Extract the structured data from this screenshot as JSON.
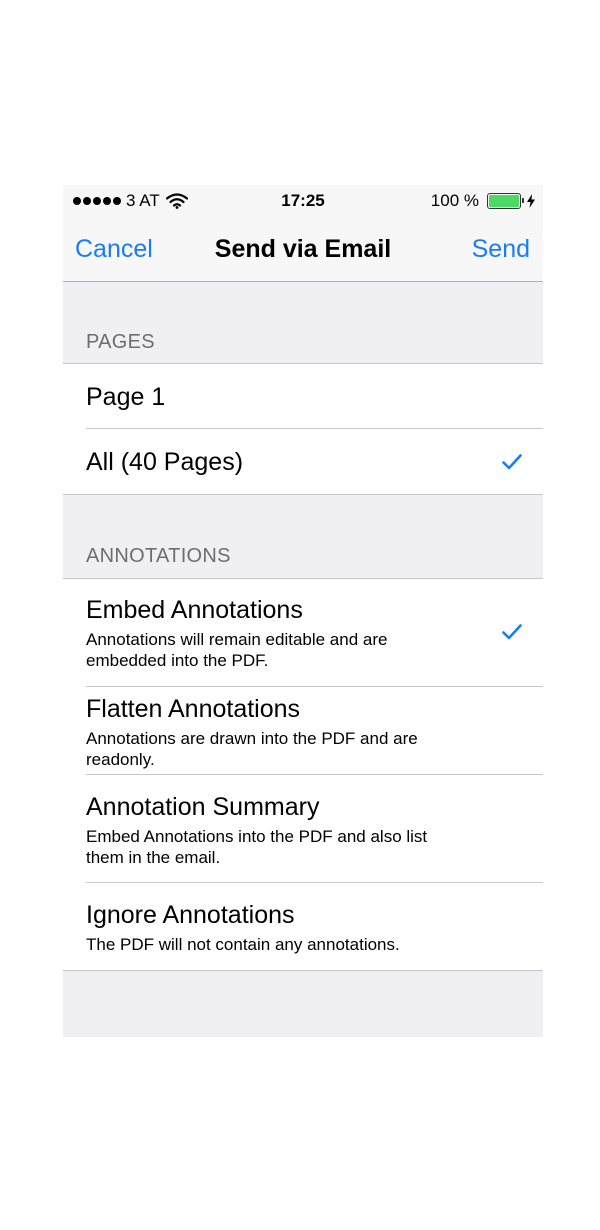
{
  "status_bar": {
    "carrier": "3 AT",
    "time": "17:25",
    "battery": "100 %",
    "battery_level": 1.0,
    "icons": [
      "signal-dots-icon",
      "wifi-icon",
      "battery-icon",
      "charging-bolt-icon"
    ]
  },
  "nav": {
    "cancel_label": "Cancel",
    "title": "Send via Email",
    "send_label": "Send"
  },
  "pages_section": {
    "header": "PAGES",
    "options": [
      {
        "label": "Page 1",
        "selected": false
      },
      {
        "label": "All (40 Pages)",
        "selected": true
      }
    ]
  },
  "annotations_section": {
    "header": "ANNOTATIONS",
    "options": [
      {
        "title": "Embed Annotations",
        "description": "Annotations will remain editable and are embedded into the PDF.",
        "selected": true
      },
      {
        "title": "Flatten Annotations",
        "description": "Annotations are drawn into the PDF and are readonly.",
        "selected": false
      },
      {
        "title": "Annotation Summary",
        "description": "Embed Annotations into the PDF and also list them in the email.",
        "selected": false
      },
      {
        "title": "Ignore Annotations",
        "description": "The PDF will not contain any annotations.",
        "selected": false
      }
    ]
  },
  "colors": {
    "accent": "#1a7cf5",
    "group_background": "#efeff4",
    "section_header_text": "#6d6d72",
    "separator": "#c8c7cc",
    "battery_fill": "#4cd964"
  }
}
